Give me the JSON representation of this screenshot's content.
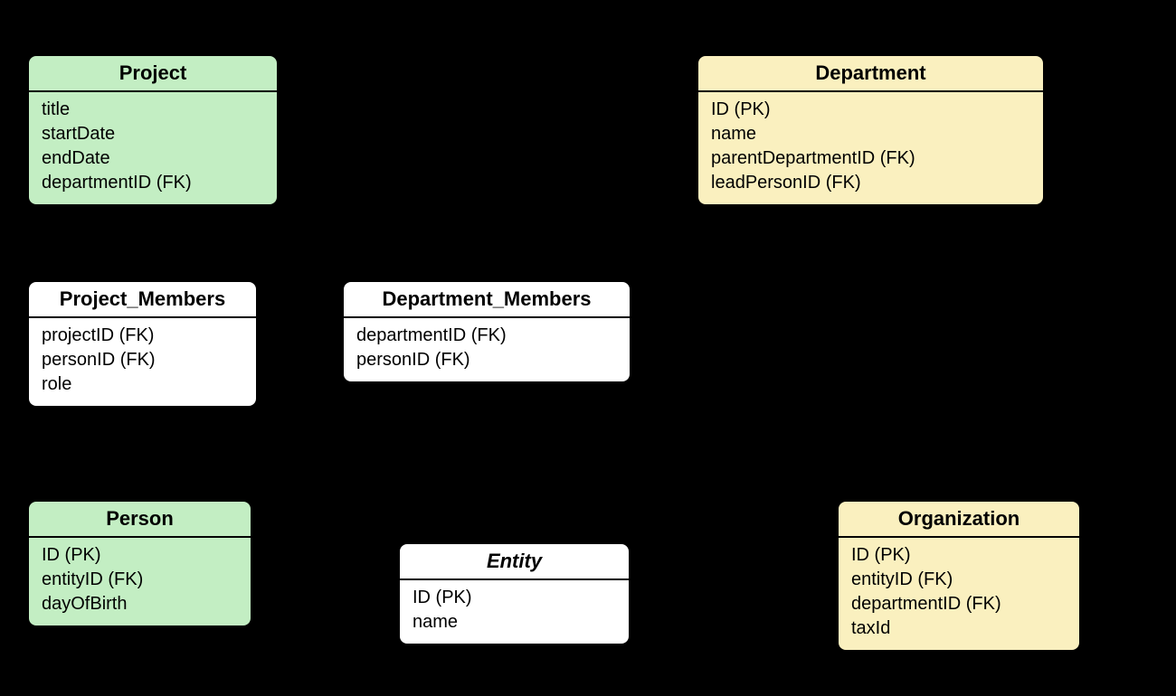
{
  "entities": {
    "project": {
      "title": "Project",
      "attrs": [
        "title",
        "startDate",
        "endDate",
        "departmentID (FK)"
      ]
    },
    "department": {
      "title": "Department",
      "attrs": [
        "ID (PK)",
        "name",
        "parentDepartmentID (FK)",
        "leadPersonID (FK)"
      ]
    },
    "project_members": {
      "title": "Project_Members",
      "attrs": [
        "projectID (FK)",
        "personID (FK)",
        "role"
      ]
    },
    "department_members": {
      "title": "Department_Members",
      "attrs": [
        "departmentID (FK)",
        "personID (FK)"
      ]
    },
    "person": {
      "title": "Person",
      "attrs": [
        "ID (PK)",
        "entityID (FK)",
        "dayOfBirth"
      ]
    },
    "organization": {
      "title": "Organization",
      "attrs": [
        "ID (PK)",
        "entityID (FK)",
        "departmentID (FK)",
        "taxId"
      ]
    },
    "entity": {
      "title": "Entity",
      "attrs": [
        "ID (PK)",
        "name"
      ]
    }
  }
}
